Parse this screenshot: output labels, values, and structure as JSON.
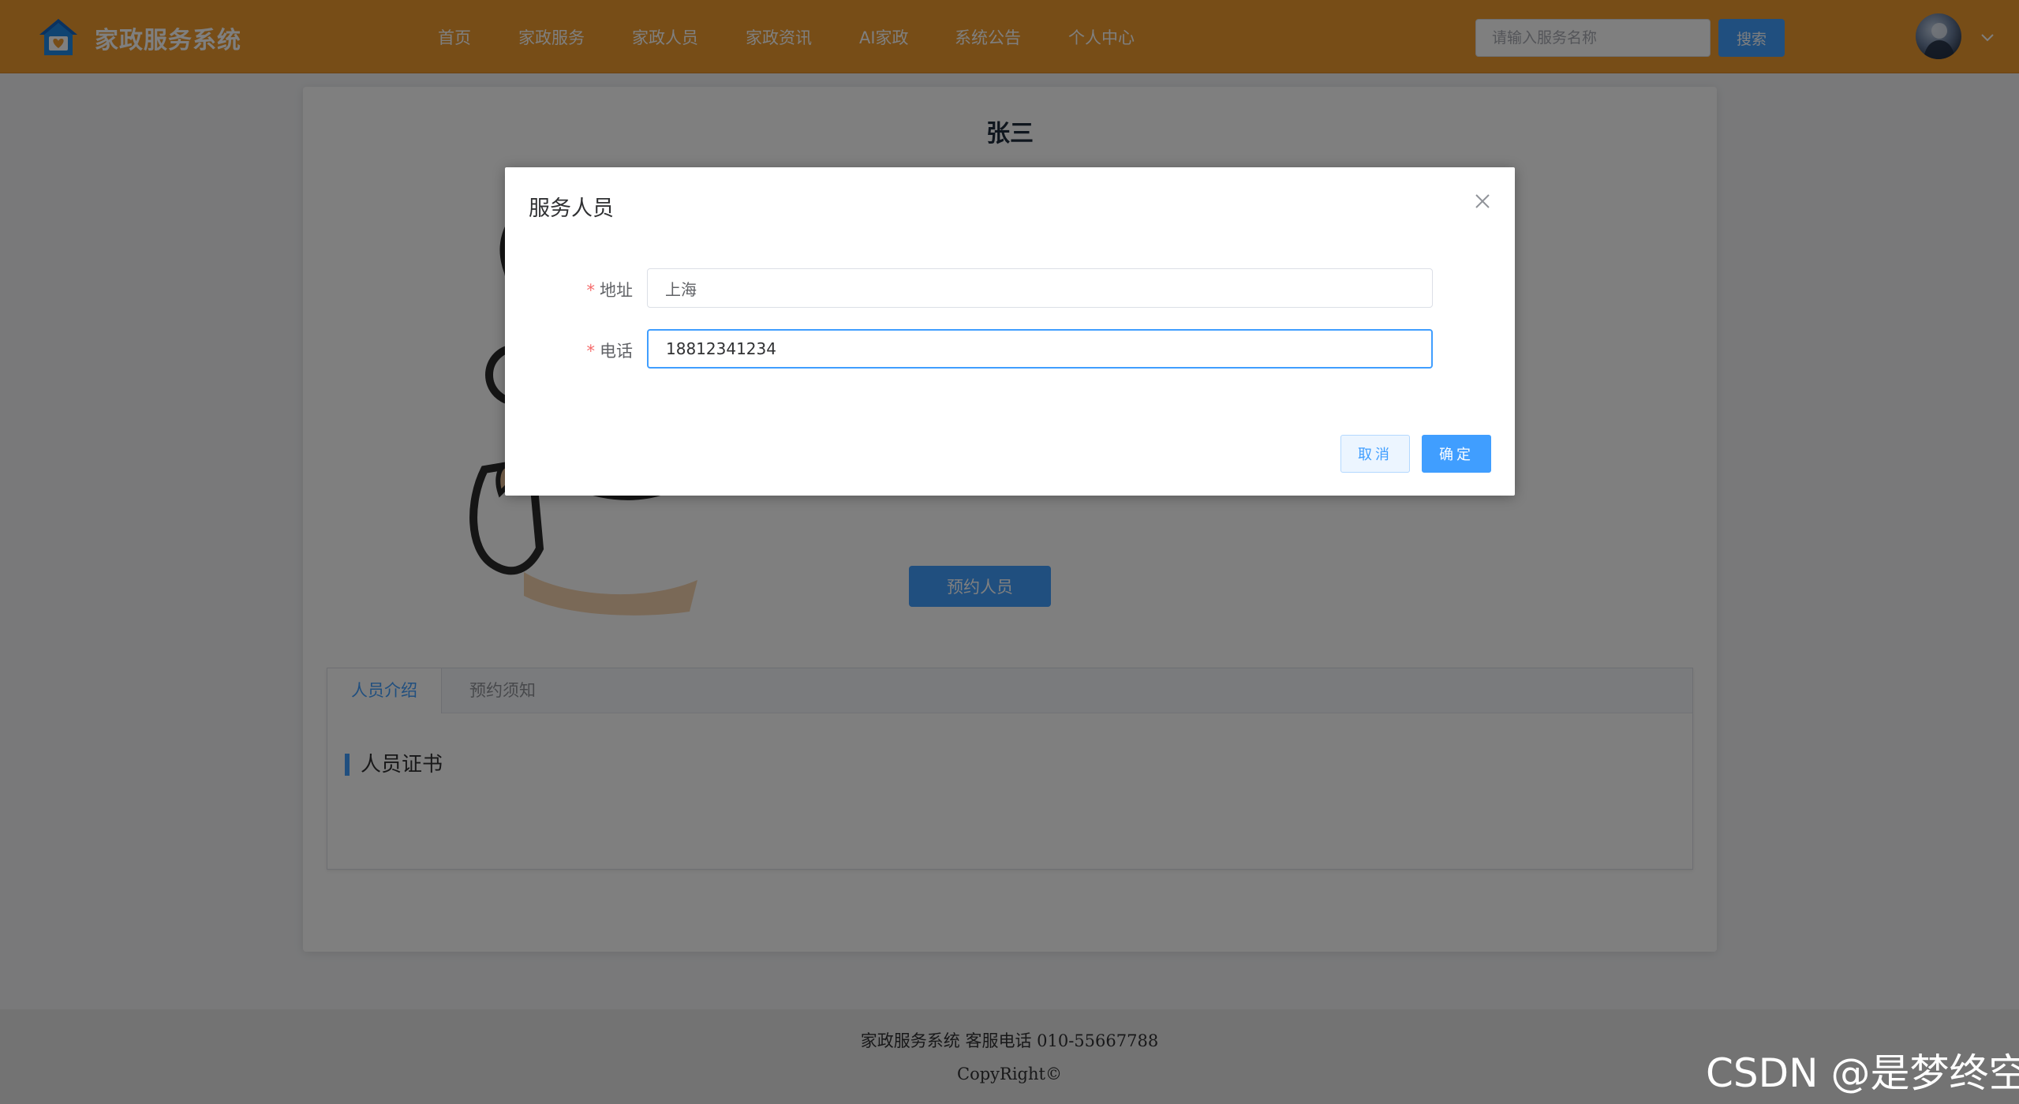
{
  "header": {
    "app_title": "家政服务系统",
    "nav": [
      "首页",
      "家政服务",
      "家政人员",
      "家政资讯",
      "AI家政",
      "系统公告",
      "个人中心"
    ],
    "search_placeholder": "请输入服务名称",
    "search_button": "搜索"
  },
  "detail": {
    "person_name": "张三",
    "book_button": "预约人员",
    "tabs": [
      "人员介绍",
      "预约须知"
    ],
    "active_tab": "人员介绍",
    "section_title": "人员证书"
  },
  "dialog": {
    "title": "服务人员",
    "fields": [
      {
        "label": "地址",
        "value": "上海",
        "required": true
      },
      {
        "label": "电话",
        "value": "18812341234",
        "required": true
      }
    ],
    "cancel": "取消",
    "confirm": "确定"
  },
  "footer": {
    "line1": "家政服务系统 客服电话 010-55667788",
    "line2": "CopyRight©"
  },
  "watermark": "CSDN @是梦终空",
  "colors": {
    "header_bg": "#ee9a2e",
    "primary": "#409eff",
    "required_mark": "#f56c6c"
  },
  "icons": {
    "logo": "house-heart-icon",
    "close": "close-icon",
    "user_menu": "chevron-down-icon"
  }
}
